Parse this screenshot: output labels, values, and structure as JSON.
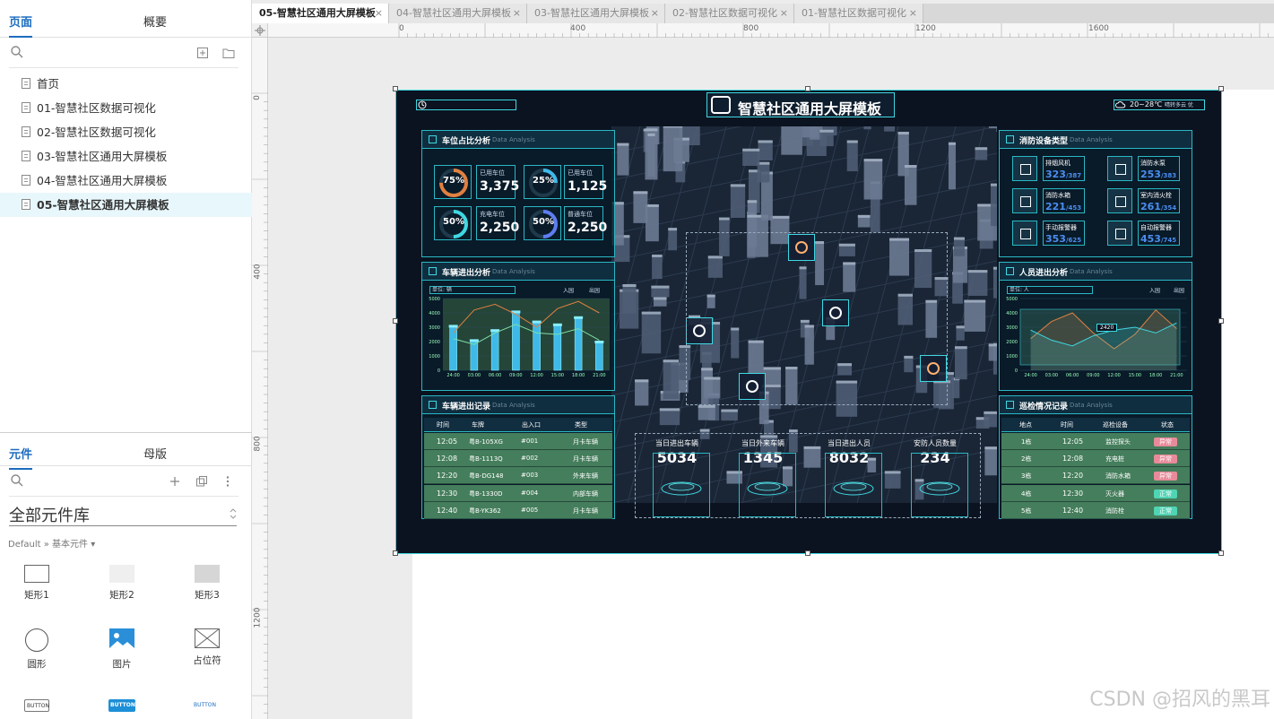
{
  "left_panel": {
    "tabs": [
      {
        "label": "页面",
        "active": true
      },
      {
        "label": "概要",
        "active": false
      }
    ],
    "pages": [
      {
        "label": "首页",
        "selected": false
      },
      {
        "label": "01-智慧社区数据可视化",
        "selected": false
      },
      {
        "label": "02-智慧社区数据可视化",
        "selected": false
      },
      {
        "label": "03-智慧社区通用大屏模板",
        "selected": false
      },
      {
        "label": "04-智慧社区通用大屏模板",
        "selected": false
      },
      {
        "label": "05-智慧社区通用大屏模板",
        "selected": true
      }
    ],
    "lib_tabs": [
      {
        "label": "元件",
        "active": true
      },
      {
        "label": "母版",
        "active": false
      }
    ],
    "library_title": "全部元件库",
    "breadcrumb": "Default » 基本元件 ▾",
    "widgets": [
      {
        "label": "矩形1",
        "icon": "rect-outline-icon"
      },
      {
        "label": "矩形2",
        "icon": "rect-light-icon"
      },
      {
        "label": "矩形3",
        "icon": "rect-gray-icon"
      },
      {
        "label": "圆形",
        "icon": "circle-icon"
      },
      {
        "label": "图片",
        "icon": "image-icon"
      },
      {
        "label": "占位符",
        "icon": "placeholder-icon"
      }
    ],
    "button_widgets": [
      "BUTTON",
      "BUTTON",
      "BUTTON"
    ]
  },
  "doc_tabs": [
    {
      "label": "05-智慧社区通用大屏模板",
      "active": true
    },
    {
      "label": "04-智慧社区通用大屏模板",
      "active": false
    },
    {
      "label": "03-智慧社区通用大屏模板",
      "active": false
    },
    {
      "label": "02-智慧社区数据可视化",
      "active": false
    },
    {
      "label": "01-智慧社区数据可视化",
      "active": false
    }
  ],
  "ruler": {
    "h_labels": [
      "0",
      "400",
      "800",
      "1200",
      "1600"
    ],
    "v_labels": [
      "0",
      "400",
      "800",
      "1200"
    ]
  },
  "watermark": "CSDN @招风的黑耳",
  "dashboard": {
    "title": "智慧社区通用大屏模板",
    "weather": "20~28℃",
    "weather_note": "晴转多云 优",
    "parking": {
      "title": "车位占比分析",
      "subtitle": "Data Analysis",
      "rings": [
        {
          "value": "75%",
          "pct": 0.75,
          "color": "#e08040"
        },
        {
          "value": "25%",
          "pct": 0.25,
          "color": "#3fb9e8"
        },
        {
          "value": "50%",
          "pct": 0.5,
          "color": "#3fd8e2"
        },
        {
          "value": "50%",
          "pct": 0.5,
          "color": "#5d7df0"
        }
      ],
      "stats": [
        {
          "label": "已用车位",
          "value": "3,375"
        },
        {
          "label": "已用车位",
          "value": "1,125"
        },
        {
          "label": "充电车位",
          "value": "2,250"
        },
        {
          "label": "普通车位",
          "value": "2,250"
        }
      ]
    },
    "fire": {
      "title": "消防设备类型",
      "subtitle": "Data Analysis",
      "items": [
        {
          "label": "排烟风机",
          "value": "323",
          "total": "/387"
        },
        {
          "label": "消防水泵",
          "value": "253",
          "total": "/383"
        },
        {
          "label": "消防水箱",
          "value": "221",
          "total": "/453"
        },
        {
          "label": "室内消火栓",
          "value": "261",
          "total": "/354"
        },
        {
          "label": "手动报警器",
          "value": "353",
          "total": "/625"
        },
        {
          "label": "自动报警器",
          "value": "453",
          "total": "/745"
        }
      ]
    },
    "vehicle_flow": {
      "title": "车辆进出分析",
      "subtitle": "Data Analysis",
      "unit": "单位: 辆",
      "legend": [
        "入园",
        "出园"
      ]
    },
    "people_flow": {
      "title": "人员进出分析",
      "subtitle": "Data Analysis",
      "unit": "单位: 人",
      "legend": [
        "入园",
        "出园"
      ],
      "tooltip": "2420"
    },
    "vehicle_records": {
      "title": "车辆进出记录",
      "subtitle": "Data Analysis",
      "headers": [
        "时间",
        "车牌",
        "出入口",
        "类型"
      ],
      "rows": [
        [
          "12:05",
          "粤B-105XG",
          "#001",
          "月卡车辆"
        ],
        [
          "12:08",
          "粤B-1113Q",
          "#002",
          "月卡车辆"
        ],
        [
          "12:20",
          "粤B-DG148",
          "#003",
          "外来车辆"
        ],
        [
          "12:30",
          "粤B-1330D",
          "#004",
          "内部车辆"
        ],
        [
          "12:40",
          "粤B-YK362",
          "#005",
          "月卡车辆"
        ]
      ]
    },
    "patrol_records": {
      "title": "巡检情况记录",
      "subtitle": "Data Analysis",
      "headers": [
        "地点",
        "时间",
        "巡检设备",
        "状态"
      ],
      "rows": [
        [
          "1栋",
          "12:05",
          "监控探头",
          "异常"
        ],
        [
          "2栋",
          "12:08",
          "充电桩",
          "异常"
        ],
        [
          "3栋",
          "12:20",
          "消防水箱",
          "异常"
        ],
        [
          "4栋",
          "12:30",
          "灭火器",
          "正常"
        ],
        [
          "5栋",
          "12:40",
          "消防栓",
          "正常"
        ]
      ],
      "status_colors": {
        "异常": "#e88a9a",
        "正常": "#4fd4b4"
      }
    },
    "kpis": [
      {
        "label": "当日进出车辆",
        "value": "5034"
      },
      {
        "label": "当日外来车辆",
        "value": "1345"
      },
      {
        "label": "当日进出人员",
        "value": "8032"
      },
      {
        "label": "安防人员数量",
        "value": "234"
      }
    ],
    "chart_data": [
      {
        "type": "bar",
        "categories": [
          "24:00",
          "03:00",
          "06:00",
          "09:00",
          "12:00",
          "15:00",
          "18:00",
          "21:00"
        ],
        "values": [
          3100,
          2100,
          2800,
          4100,
          3400,
          3200,
          3700,
          2000
        ],
        "line_series": [
          {
            "name": "入园",
            "values": [
              2600,
              4200,
              4600,
              3900,
              3000,
              4300,
              4800,
              4000
            ],
            "color": "#e08040"
          },
          {
            "name": "出园",
            "values": [
              2200,
              1800,
              2600,
              3200,
              2600,
              2500,
              2900,
              2100
            ],
            "color": "#7ee0a8"
          }
        ],
        "ylim": [
          0,
          5000
        ],
        "yticks": [
          "0",
          "1000",
          "2000",
          "3000",
          "4000",
          "5000"
        ]
      },
      {
        "type": "area",
        "categories": [
          "24:00",
          "03:00",
          "06:00",
          "09:00",
          "12:00",
          "15:00",
          "18:00",
          "21:00"
        ],
        "series": [
          {
            "name": "入园",
            "values": [
              2200,
              3400,
              4000,
              2600,
              1500,
              2500,
              4200,
              2900
            ],
            "color": "#e08040"
          },
          {
            "name": "出园",
            "values": [
              2800,
              2100,
              1700,
              2400,
              2800,
              3000,
              2600,
              3300
            ],
            "color": "#3fd8e2"
          }
        ],
        "ylim": [
          0,
          5000
        ],
        "yticks": [
          "0",
          "1000",
          "2000",
          "3000",
          "4000",
          "5000"
        ]
      }
    ]
  }
}
